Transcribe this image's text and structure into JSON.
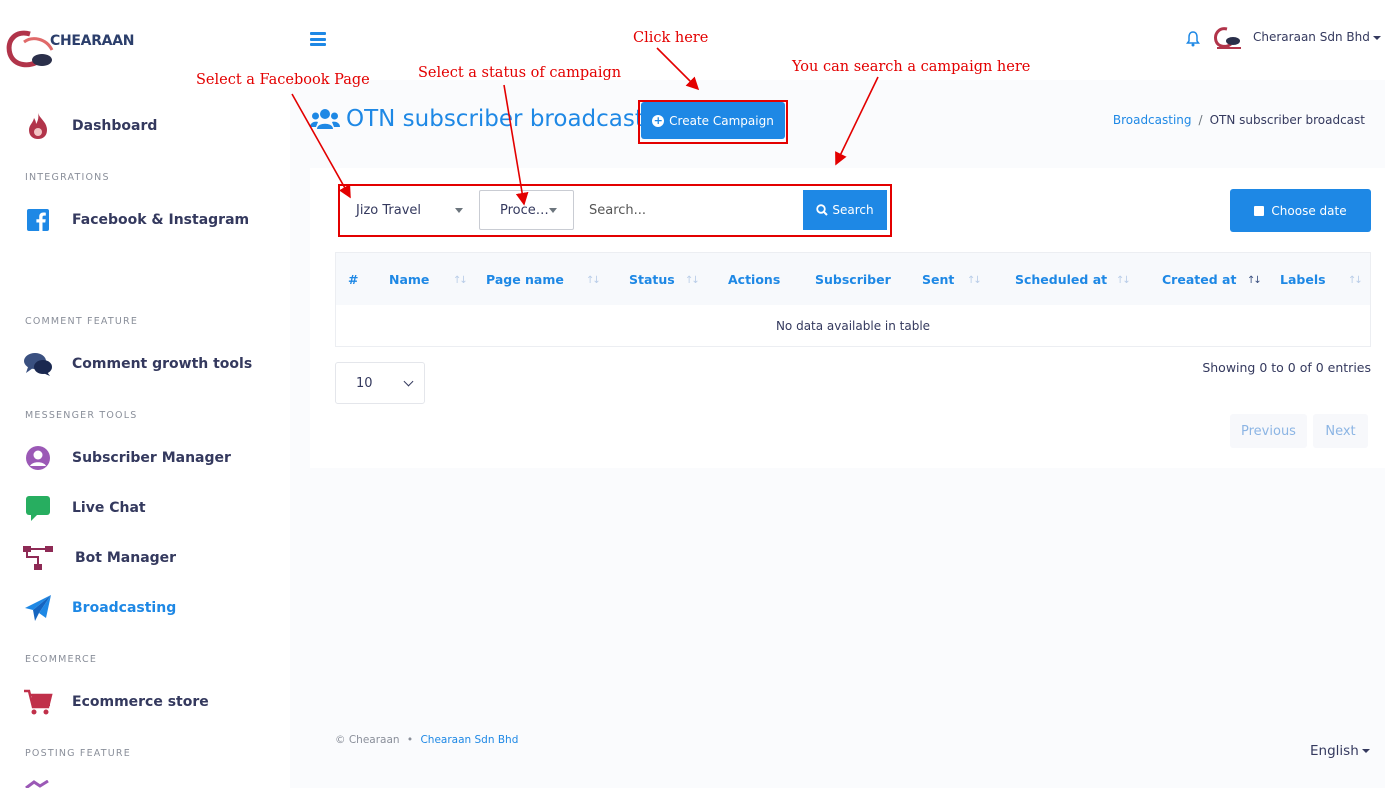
{
  "brand": {
    "name": "CHEARAAN"
  },
  "topbar": {
    "user_name": "Cheraraan Sdn Bhd"
  },
  "sidebar": {
    "items": [
      {
        "label": "Dashboard"
      },
      {
        "label": "Facebook & Instagram"
      },
      {
        "label": "Comment growth tools"
      },
      {
        "label": "Subscriber Manager"
      },
      {
        "label": "Live Chat"
      },
      {
        "label": "Bot Manager"
      },
      {
        "label": "Broadcasting"
      },
      {
        "label": "Ecommerce store"
      }
    ],
    "headings": [
      "INTEGRATIONS",
      "COMMENT FEATURE",
      "MESSENGER TOOLS",
      "ECOMMERCE",
      "POSTING FEATURE"
    ]
  },
  "page": {
    "title": "OTN subscriber broadcast",
    "create_button": "Create Campaign",
    "breadcrumb": {
      "parent": "Broadcasting",
      "current": "OTN subscriber broadcast"
    }
  },
  "filters": {
    "page_select": "Jizo Travel",
    "status_select": "Proce…",
    "search_placeholder": "Search...",
    "search_button": "Search",
    "date_button": "Choose date"
  },
  "table": {
    "columns": [
      "#",
      "Name",
      "Page name",
      "Status",
      "Actions",
      "Subscriber",
      "Sent",
      "Scheduled at",
      "Created at",
      "Labels"
    ],
    "empty_message": "No data available in table"
  },
  "pagination": {
    "page_length": "10",
    "info": "Showing 0 to 0 of 0 entries",
    "previous": "Previous",
    "next": "Next"
  },
  "footer": {
    "copyright": "© Chearaan",
    "bullet": "•",
    "company_link": "Chearaan Sdn Bhd",
    "language": "English"
  },
  "annotations": {
    "click_here": "Click here",
    "select_page": "Select a Facebook Page",
    "select_status": "Select a status of campaign",
    "search_hint": "You can search a campaign here"
  },
  "colors": {
    "accent": "#1e88e5",
    "annotation": "#e30000",
    "text": "#34395e"
  }
}
